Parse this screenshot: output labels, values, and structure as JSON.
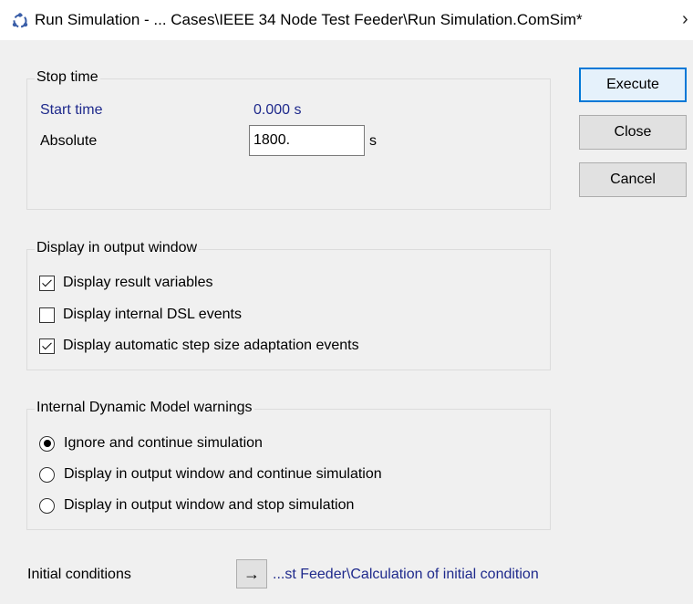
{
  "window": {
    "title": "Run Simulation - ... Cases\\IEEE 34 Node Test Feeder\\Run Simulation.ComSim*",
    "chevron": "›"
  },
  "stop_time": {
    "legend": "Stop time",
    "start_label": "Start time",
    "start_value": "0.000 s",
    "absolute_label": "Absolute",
    "absolute_value": "1800.",
    "unit": "s"
  },
  "display": {
    "legend": "Display in output window",
    "options": [
      {
        "label": "Display result variables",
        "checked": true
      },
      {
        "label": "Display internal DSL events",
        "checked": false
      },
      {
        "label": "Display automatic step size adaptation events",
        "checked": true
      }
    ]
  },
  "warnings": {
    "legend": "Internal Dynamic Model warnings",
    "options": [
      {
        "label": "Ignore and continue simulation",
        "selected": true
      },
      {
        "label": "Display in output window and continue simulation",
        "selected": false
      },
      {
        "label": "Display in output window and stop simulation",
        "selected": false
      }
    ]
  },
  "initial": {
    "label": "Initial conditions",
    "arrow": "→",
    "link": "...st Feeder\\Calculation of initial condition"
  },
  "buttons": {
    "execute": "Execute",
    "close": "Close",
    "cancel": "Cancel"
  }
}
